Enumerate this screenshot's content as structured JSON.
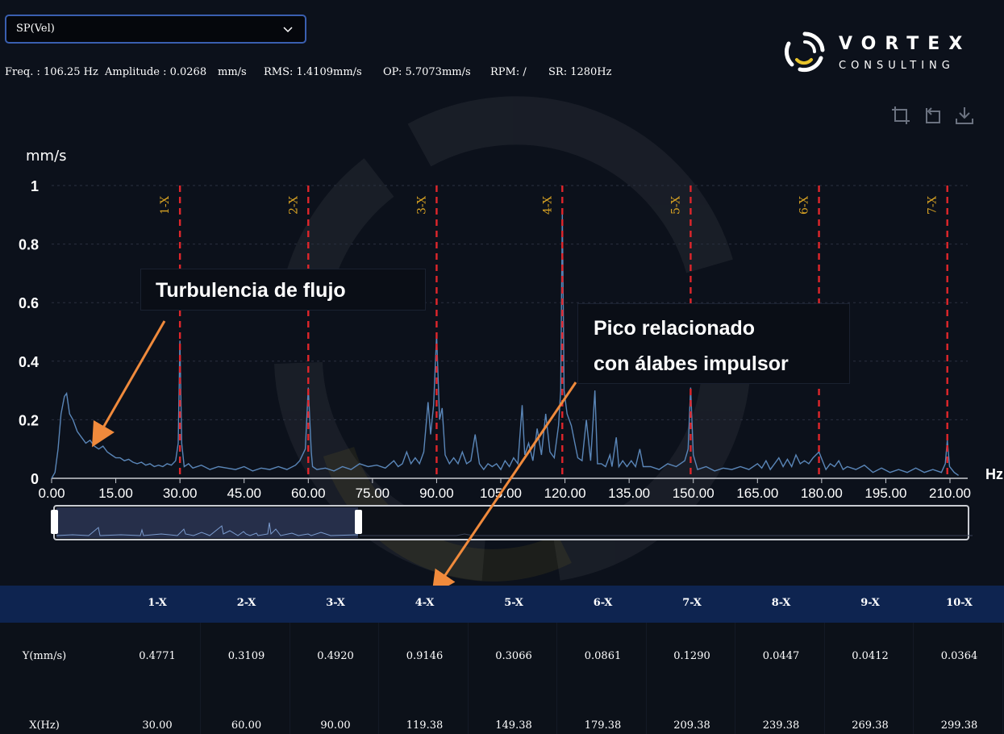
{
  "selector": {
    "value": "SP(Vel)"
  },
  "brand": {
    "name": "VORTEX",
    "sub": "CONSULTING"
  },
  "stats": {
    "freq": "Freq. : 106.25 Hz",
    "amplitude": "Amplitude : 0.0268",
    "amplitude_unit": "mm/s",
    "rms": "RMS: 1.4109mm/s",
    "op": "OP: 5.7073mm/s",
    "rpm": "RPM: /",
    "sr": "SR: 1280Hz"
  },
  "toolbar": {
    "icons": [
      "zoom-select-icon",
      "zoom-reset-icon",
      "download-icon"
    ]
  },
  "chart_data": {
    "type": "line",
    "ylabel": "mm/s",
    "xlabel": "Hz",
    "xlim": [
      0,
      212
    ],
    "ylim": [
      0,
      1
    ],
    "y_ticks": [
      "0",
      "0.2",
      "0.4",
      "0.6",
      "0.8",
      "1"
    ],
    "x_ticks": [
      "0.00",
      "15.00",
      "30.00",
      "45.00",
      "60.00",
      "75.00",
      "90.00",
      "105.00",
      "120.00",
      "135.00",
      "150.00",
      "165.00",
      "180.00",
      "195.00",
      "210.00"
    ],
    "grid": true,
    "harmonic_markers": [
      {
        "label": "1-X",
        "x": 30
      },
      {
        "label": "2-X",
        "x": 60
      },
      {
        "label": "3-X",
        "x": 90
      },
      {
        "label": "4-X",
        "x": 119.38
      },
      {
        "label": "5-X",
        "x": 149.38
      },
      {
        "label": "6-X",
        "x": 179.38
      },
      {
        "label": "7-X",
        "x": 209.38
      }
    ],
    "series": [
      {
        "values": [
          [
            0,
            0.0
          ],
          [
            0.8,
            0.02
          ],
          [
            1.5,
            0.1
          ],
          [
            2.2,
            0.22
          ],
          [
            3.0,
            0.28
          ],
          [
            3.5,
            0.29
          ],
          [
            4.2,
            0.22
          ],
          [
            5,
            0.2
          ],
          [
            6,
            0.16
          ],
          [
            7,
            0.14
          ],
          [
            8,
            0.12
          ],
          [
            9,
            0.13
          ],
          [
            10,
            0.11
          ],
          [
            11,
            0.1
          ],
          [
            12,
            0.11
          ],
          [
            13,
            0.09
          ],
          [
            14,
            0.08
          ],
          [
            15,
            0.07
          ],
          [
            16,
            0.07
          ],
          [
            17,
            0.06
          ],
          [
            18,
            0.065
          ],
          [
            19,
            0.055
          ],
          [
            20,
            0.05
          ],
          [
            21,
            0.055
          ],
          [
            22,
            0.045
          ],
          [
            23,
            0.05
          ],
          [
            24,
            0.04
          ],
          [
            25,
            0.045
          ],
          [
            26,
            0.04
          ],
          [
            27,
            0.05
          ],
          [
            28,
            0.045
          ],
          [
            29,
            0.06
          ],
          [
            29.6,
            0.12
          ],
          [
            30,
            0.47
          ],
          [
            30.4,
            0.12
          ],
          [
            31,
            0.04
          ],
          [
            32,
            0.05
          ],
          [
            33,
            0.035
          ],
          [
            35,
            0.045
          ],
          [
            37,
            0.03
          ],
          [
            39,
            0.04
          ],
          [
            41,
            0.035
          ],
          [
            43,
            0.03
          ],
          [
            45,
            0.04
          ],
          [
            47,
            0.025
          ],
          [
            49,
            0.035
          ],
          [
            51,
            0.03
          ],
          [
            53,
            0.04
          ],
          [
            55,
            0.03
          ],
          [
            57,
            0.045
          ],
          [
            58,
            0.06
          ],
          [
            59.3,
            0.1
          ],
          [
            60,
            0.31
          ],
          [
            60.7,
            0.09
          ],
          [
            61,
            0.04
          ],
          [
            62,
            0.03
          ],
          [
            64,
            0.035
          ],
          [
            66,
            0.025
          ],
          [
            68,
            0.04
          ],
          [
            70,
            0.03
          ],
          [
            72,
            0.05
          ],
          [
            74,
            0.04
          ],
          [
            76,
            0.045
          ],
          [
            78,
            0.035
          ],
          [
            80,
            0.06
          ],
          [
            81,
            0.04
          ],
          [
            82,
            0.05
          ],
          [
            83,
            0.09
          ],
          [
            84,
            0.05
          ],
          [
            85,
            0.07
          ],
          [
            86,
            0.05
          ],
          [
            87,
            0.09
          ],
          [
            88,
            0.26
          ],
          [
            88.6,
            0.15
          ],
          [
            89.3,
            0.25
          ],
          [
            90,
            0.49
          ],
          [
            90.7,
            0.2
          ],
          [
            91.3,
            0.24
          ],
          [
            92,
            0.08
          ],
          [
            93,
            0.05
          ],
          [
            94,
            0.07
          ],
          [
            95,
            0.05
          ],
          [
            96,
            0.09
          ],
          [
            97,
            0.05
          ],
          [
            98,
            0.06
          ],
          [
            99,
            0.15
          ],
          [
            100,
            0.05
          ],
          [
            101,
            0.03
          ],
          [
            102,
            0.05
          ],
          [
            103,
            0.04
          ],
          [
            104,
            0.05
          ],
          [
            105,
            0.03
          ],
          [
            106,
            0.06
          ],
          [
            107,
            0.04
          ],
          [
            108,
            0.07
          ],
          [
            109,
            0.05
          ],
          [
            110,
            0.25
          ],
          [
            110.6,
            0.08
          ],
          [
            111.5,
            0.12
          ],
          [
            112.5,
            0.06
          ],
          [
            113.5,
            0.17
          ],
          [
            114.5,
            0.08
          ],
          [
            115.5,
            0.22
          ],
          [
            116.5,
            0.09
          ],
          [
            117.5,
            0.07
          ],
          [
            118.5,
            0.18
          ],
          [
            119,
            0.3
          ],
          [
            119.38,
            0.91
          ],
          [
            119.8,
            0.3
          ],
          [
            120.5,
            0.22
          ],
          [
            121.5,
            0.18
          ],
          [
            122.3,
            0.12
          ],
          [
            123,
            0.07
          ],
          [
            124,
            0.06
          ],
          [
            125,
            0.2
          ],
          [
            126,
            0.06
          ],
          [
            127,
            0.3
          ],
          [
            127.6,
            0.05
          ],
          [
            128.5,
            0.05
          ],
          [
            129.5,
            0.04
          ],
          [
            130.5,
            0.08
          ],
          [
            131,
            0.04
          ],
          [
            132,
            0.14
          ],
          [
            132.6,
            0.04
          ],
          [
            133.5,
            0.06
          ],
          [
            134.5,
            0.04
          ],
          [
            135.5,
            0.06
          ],
          [
            136.5,
            0.04
          ],
          [
            137.5,
            0.1
          ],
          [
            138.3,
            0.04
          ],
          [
            140,
            0.04
          ],
          [
            142,
            0.03
          ],
          [
            144,
            0.05
          ],
          [
            146,
            0.04
          ],
          [
            148,
            0.06
          ],
          [
            148.8,
            0.1
          ],
          [
            149.38,
            0.31
          ],
          [
            150,
            0.08
          ],
          [
            151,
            0.03
          ],
          [
            153,
            0.04
          ],
          [
            155,
            0.025
          ],
          [
            157,
            0.035
          ],
          [
            159,
            0.03
          ],
          [
            161,
            0.04
          ],
          [
            163,
            0.03
          ],
          [
            165,
            0.05
          ],
          [
            166,
            0.035
          ],
          [
            167,
            0.06
          ],
          [
            168,
            0.03
          ],
          [
            169,
            0.05
          ],
          [
            170,
            0.07
          ],
          [
            171,
            0.04
          ],
          [
            172,
            0.065
          ],
          [
            173,
            0.04
          ],
          [
            174,
            0.08
          ],
          [
            175,
            0.05
          ],
          [
            176,
            0.06
          ],
          [
            177,
            0.05
          ],
          [
            178,
            0.07
          ],
          [
            179.38,
            0.09
          ],
          [
            180.2,
            0.06
          ],
          [
            181,
            0.03
          ],
          [
            182,
            0.05
          ],
          [
            183,
            0.04
          ],
          [
            184,
            0.06
          ],
          [
            185,
            0.03
          ],
          [
            186,
            0.04
          ],
          [
            188,
            0.03
          ],
          [
            190,
            0.045
          ],
          [
            192,
            0.02
          ],
          [
            194,
            0.035
          ],
          [
            196,
            0.02
          ],
          [
            198,
            0.03
          ],
          [
            200,
            0.02
          ],
          [
            202,
            0.035
          ],
          [
            204,
            0.02
          ],
          [
            206,
            0.03
          ],
          [
            208,
            0.02
          ],
          [
            208.9,
            0.05
          ],
          [
            209.38,
            0.13
          ],
          [
            209.9,
            0.04
          ],
          [
            211,
            0.02
          ],
          [
            212,
            0.01
          ]
        ]
      }
    ]
  },
  "annotations": {
    "turbulence": "Turbulencia de flujo",
    "peak_line1": "Pico relacionado",
    "peak_line2": "con álabes impulsor"
  },
  "table": {
    "headers": [
      "1-X",
      "2-X",
      "3-X",
      "4-X",
      "5-X",
      "6-X",
      "7-X",
      "8-X",
      "9-X",
      "10-X"
    ],
    "rows": [
      {
        "label": "Y(mm/s)",
        "values": [
          "0.4771",
          "0.3109",
          "0.4920",
          "0.9146",
          "0.3066",
          "0.0861",
          "0.1290",
          "0.0447",
          "0.0412",
          "0.0364"
        ]
      },
      {
        "label": "X(Hz)",
        "values": [
          "30.00",
          "60.00",
          "90.00",
          "119.38",
          "149.38",
          "179.38",
          "209.38",
          "239.38",
          "269.38",
          "299.38"
        ]
      }
    ]
  },
  "colors": {
    "background": "#0c111b",
    "series": "#5a86b8",
    "marker": "#e0262b",
    "marker_label": "#d9a323",
    "arrow": "#f08a3c",
    "dropdown_border": "#3a5fb0",
    "table_header": "#0e2450"
  }
}
